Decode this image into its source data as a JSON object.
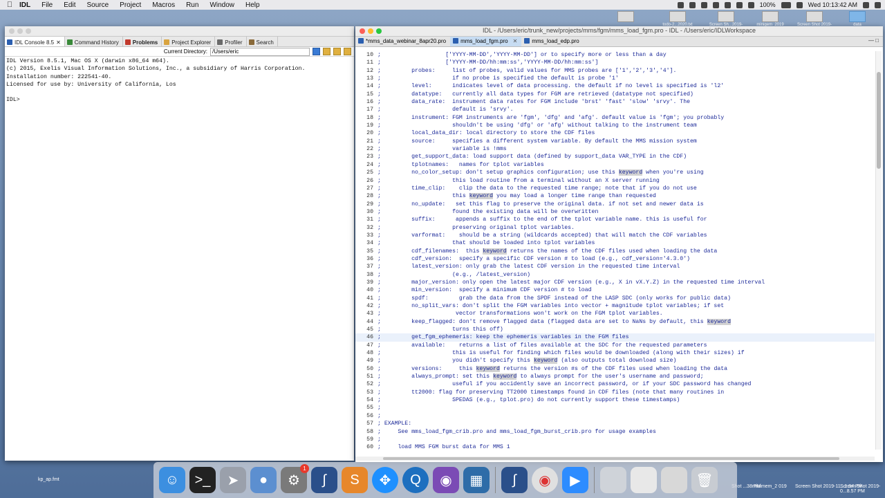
{
  "menubar": {
    "items": [
      "IDL",
      "File",
      "Edit",
      "Source",
      "Project",
      "Macros",
      "Run",
      "Window",
      "Help"
    ],
    "battery": "100%",
    "clock": "Wed 10:13:42 AM"
  },
  "desktop_icons": [
    {
      "label": "todo-2...2020.txt"
    },
    {
      "label": "Screen Sh...2019-1...11.11 PM"
    },
    {
      "label": "minigem_2019"
    },
    {
      "label": "Screen Shot 2019-11...10 PM"
    },
    {
      "label": "data"
    }
  ],
  "console": {
    "tabs": [
      {
        "label": "IDL Console 8.5"
      },
      {
        "label": "Command History"
      },
      {
        "label": "Problems"
      },
      {
        "label": "Project Explorer"
      },
      {
        "label": "Profiler"
      },
      {
        "label": "Search"
      }
    ],
    "current_dir_label": "Current Directory:",
    "current_dir": "/Users/eric",
    "output": "IDL Version 8.5.1, Mac OS X (darwin x86_64 m64).\n(c) 2015, Exelis Visual Information Solutions, Inc., a subsidiary of Harris Corporation.\nInstallation number: 222541-40.\nLicensed for use by: University of California, Los\n\nIDL>"
  },
  "editor": {
    "title": "IDL - /Users/eric/trunk_new/projects/mms/fgm/mms_load_fgm.pro - IDL - /Users/eric/IDLWorkspace",
    "tabs": [
      {
        "label": "*mms_data_webinar_8apr20.pro"
      },
      {
        "label": "mms_load_fgm.pro"
      },
      {
        "label": "mms_load_edp.pro"
      }
    ],
    "lines": [
      {
        "n": "10",
        "t": ";                   ['YYYY-MM-DD','YYYY-MM-DD'] or to specify more or less than a day"
      },
      {
        "n": "11",
        "t": ";                   ['YYYY-MM-DD/hh:mm:ss','YYYY-MM-DD/hh:mm:ss']"
      },
      {
        "n": "12",
        "t": ";         probes:     list of probes, valid values for MMS probes are ['1','2','3','4']."
      },
      {
        "n": "13",
        "t": ";                     if no probe is specified the default is probe '1'"
      },
      {
        "n": "14",
        "t": ";         level:      indicates level of data processing. the default if no level is specified is 'l2'"
      },
      {
        "n": "15",
        "t": ";         datatype:   currently all data types for FGM are retrieved (datatype not specified)"
      },
      {
        "n": "16",
        "t": ";         data_rate:  instrument data rates for FGM include 'brst' 'fast' 'slow' 'srvy'. The"
      },
      {
        "n": "17",
        "t": ";                     default is 'srvy'."
      },
      {
        "n": "18",
        "t": ";         instrument: FGM instruments are 'fgm', 'dfg' and 'afg'. default value is 'fgm'; you probably"
      },
      {
        "n": "19",
        "t": ";                     shouldn't be using 'dfg' or 'afg' without talking to the instrument team"
      },
      {
        "n": "20",
        "t": ";         local_data_dir: local directory to store the CDF files"
      },
      {
        "n": "21",
        "t": ";         source:     specifies a different system variable. By default the MMS mission system"
      },
      {
        "n": "22",
        "t": ";                     variable is !mms"
      },
      {
        "n": "23",
        "t": ";         get_support_data: load support data (defined by support_data VAR_TYPE in the CDF)"
      },
      {
        "n": "24",
        "t": ";         tplotnames:   names for tplot variables"
      },
      {
        "n": "25",
        "t": ";         no_color_setup: don't setup graphics configuration; use this keyword when you're using"
      },
      {
        "n": "26",
        "t": ";                     this load routine from a terminal without an X server running"
      },
      {
        "n": "27",
        "t": ";         time_clip:    clip the data to the requested time range; note that if you do not use"
      },
      {
        "n": "28",
        "t": ";                     this keyword you may load a longer time range than requested"
      },
      {
        "n": "29",
        "t": ";         no_update:   set this flag to preserve the original data. if not set and newer data is"
      },
      {
        "n": "30",
        "t": ";                     found the existing data will be overwritten"
      },
      {
        "n": "31",
        "t": ";         suffix:      appends a suffix to the end of the tplot variable name. this is useful for"
      },
      {
        "n": "32",
        "t": ";                     preserving original tplot variables."
      },
      {
        "n": "33",
        "t": ";         varformat:    should be a string (wildcards accepted) that will match the CDF variables"
      },
      {
        "n": "34",
        "t": ";                     that should be loaded into tplot variables"
      },
      {
        "n": "35",
        "t": ";         cdf_filenames:  this keyword returns the names of the CDF files used when loading the data"
      },
      {
        "n": "36",
        "t": ";         cdf_version:  specify a specific CDF version # to load (e.g., cdf_version='4.3.0')"
      },
      {
        "n": "37",
        "t": ";         latest_version: only grab the latest CDF version in the requested time interval"
      },
      {
        "n": "38",
        "t": ";                     (e.g., /latest_version)"
      },
      {
        "n": "39",
        "t": ";         major_version: only open the latest major CDF version (e.g., X in vX.Y.Z) in the requested time interval"
      },
      {
        "n": "40",
        "t": ";         min_version:  specify a minimum CDF version # to load"
      },
      {
        "n": "41",
        "t": ";         spdf:         grab the data from the SPDF instead of the LASP SDC (only works for public data)"
      },
      {
        "n": "42",
        "t": ";         no_split_vars: don't split the FGM variables into vector + magnitude tplot variables; if set"
      },
      {
        "n": "43",
        "t": ";                      vector transformations won't work on the FGM tplot variables."
      },
      {
        "n": "44",
        "t": ";         keep_flagged: don't remove flagged data (flagged data are set to NaNs by default, this keyword"
      },
      {
        "n": "45",
        "t": ";                     turns this off)"
      },
      {
        "n": "46",
        "t": ";         get_fgm_ephemeris: keep the ephemeris variables in the FGM files"
      },
      {
        "n": "47",
        "t": ";         available:    returns a list of files available at the SDC for the requested parameters"
      },
      {
        "n": "48",
        "t": ";                     this is useful for finding which files would be downloaded (along with their sizes) if"
      },
      {
        "n": "49",
        "t": ";                     you didn't specify this keyword (also outputs total download size)"
      },
      {
        "n": "50",
        "t": ";         versions:     this keyword returns the version #s of the CDF files used when loading the data"
      },
      {
        "n": "51",
        "t": ";         always_prompt: set this keyword to always prompt for the user's username and password;"
      },
      {
        "n": "52",
        "t": ";                     useful if you accidently save an incorrect password, or if your SDC password has changed"
      },
      {
        "n": "53",
        "t": ";         tt2000: flag for preserving TT2000 timestamps found in CDF files (note that many routines in"
      },
      {
        "n": "54",
        "t": ";                     SPEDAS (e.g., tplot.pro) do not currently support these timestamps)"
      },
      {
        "n": "55",
        "t": ";"
      },
      {
        "n": "56",
        "t": ";"
      },
      {
        "n": "57",
        "t": "; EXAMPLE:"
      },
      {
        "n": "58",
        "t": ";     See mms_load_fgm_crib.pro and mms_load_fgm_burst_crib.pro for usage examples"
      },
      {
        "n": "59",
        "t": ";"
      },
      {
        "n": "60",
        "t": ";     load MMS FGM burst data for MMS 1"
      },
      {
        "n": "61",
        "t": ";     MMS>  mms_load_fgm, probes=['1'], data_rate='brst'"
      }
    ]
  },
  "bottom_labels": {
    "left": "kp_ap.fmt",
    "items": [
      "Shot ...38 PM",
      "minimem_2 019",
      "Screen Shot 2019-11...1.34 PM",
      "Screen Shot 2019-0...8.57 PM"
    ]
  },
  "dock": {
    "badge": "1",
    "apps": [
      "finder-icon",
      "terminal-icon",
      "launchpad-icon",
      "preview-icon",
      "system-preferences-icon",
      "idl-icon",
      "sublime-icon",
      "safari-icon",
      "quicktime-icon",
      "github-icon",
      "virtualbox-icon",
      "idl2-icon",
      "chrome-icon",
      "zoom-icon"
    ]
  }
}
